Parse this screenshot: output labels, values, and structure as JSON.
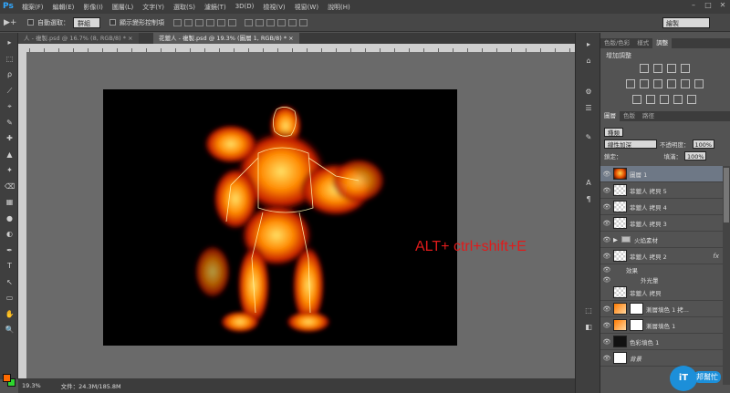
{
  "app": {
    "logo": "Ps"
  },
  "menu": [
    "檔案(F)",
    "編輯(E)",
    "影像(I)",
    "圖層(L)",
    "文字(Y)",
    "選取(S)",
    "濾鏡(T)",
    "3D(D)",
    "檢視(V)",
    "視窗(W)",
    "說明(H)"
  ],
  "window_controls": [
    "–",
    "□",
    "✕"
  ],
  "options": {
    "tool_glyph": "▶+",
    "auto_select_label": "自動選取：",
    "auto_select_value": "群組",
    "show_transform_label": "顯示變形控制項",
    "workspace": "繪製"
  },
  "tabs": [
    {
      "label": "人 - 複製.psd @ 16.7% (8, RGB/8) *  ×"
    },
    {
      "label": "花鍍人 - 複製.psd @ 19.3% (圖層 1, RGB/8) *  ×"
    }
  ],
  "canvas": {
    "shortcut_text": "ALT+ ctrl+shift+E"
  },
  "status": {
    "zoom": "19.3%",
    "doc": "文件：24.3M/185.8M"
  },
  "tools": [
    "▸",
    "⬚",
    "ρ",
    "⟋",
    "⌖",
    "✎",
    "✚",
    "▲",
    "✦",
    "⌫",
    "▦",
    "●",
    "◐",
    "✒",
    "T",
    "↖",
    "▭",
    "✋",
    "🔍"
  ],
  "dock_icons": [
    "▸",
    "⌂",
    "⚙",
    "☰",
    "✎",
    "A",
    "¶",
    "⬚",
    "◧"
  ],
  "panels": {
    "adjust_tabs": [
      "色版/色彩",
      "樣式",
      "調整"
    ],
    "adjust_title": "增加調整",
    "layers_tabs": [
      "圖層",
      "色版",
      "路徑"
    ],
    "kind_label": "種類",
    "blend_mode": "線性加深",
    "opacity_label": "不透明度：",
    "opacity_value": "100%",
    "lock_label": "鎖定：",
    "fill_label": "填滿：",
    "fill_value": "100%"
  },
  "layers": [
    {
      "name": "圖層 1",
      "thumb": "fire",
      "selected": true,
      "eye": "👁"
    },
    {
      "name": "菲鍍人 拷貝 5",
      "thumb": "checker",
      "eye": "👁"
    },
    {
      "name": "菲鍍人 拷貝 4",
      "thumb": "checker",
      "eye": "👁"
    },
    {
      "name": "菲鍍人 拷貝 3",
      "thumb": "checker",
      "eye": "👁"
    },
    {
      "name": "火焰素材",
      "thumb": "folder",
      "eye": "👁",
      "prefix": "▶"
    },
    {
      "name": "菲鍍人 拷貝 2",
      "thumb": "checker",
      "eye": "👁",
      "fx": "fx"
    },
    {
      "name": "效果",
      "sub": true,
      "eye": "👁"
    },
    {
      "name": "外光暈",
      "sub": true,
      "indent": true,
      "eye": "👁"
    },
    {
      "name": "菲鍍人 拷貝",
      "thumb": "checker",
      "eye": ""
    },
    {
      "name": "漸層填色 1 拷...",
      "thumb": "gradient",
      "mask": true,
      "eye": "👁"
    },
    {
      "name": "漸層填色 1",
      "thumb": "gradient",
      "mask": true,
      "eye": "👁"
    },
    {
      "name": "色彩填色 1",
      "thumb": "black",
      "eye": "👁"
    },
    {
      "name": "背景",
      "thumb": "white",
      "eye": "👁",
      "italic": true
    }
  ],
  "watermark": {
    "badge": "iT",
    "text": "邦幫忙"
  }
}
